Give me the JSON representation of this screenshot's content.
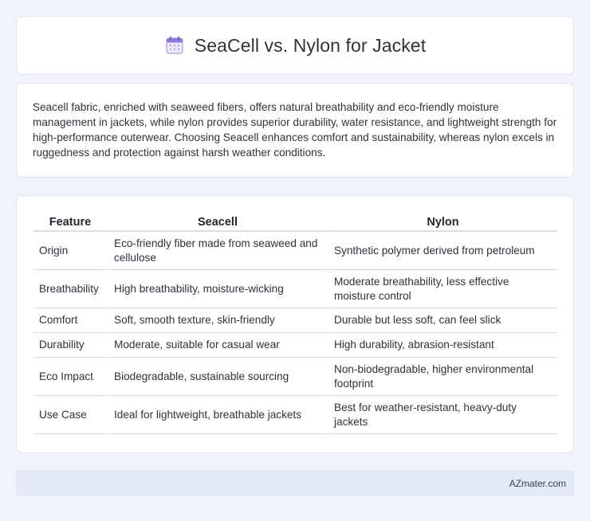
{
  "header": {
    "title": "SeaCell vs. Nylon for Jacket",
    "icon": "calendar-icon",
    "icon_color": "#8b7bd9"
  },
  "description": "Seacell fabric, enriched with seaweed fibers, offers natural breathability and eco-friendly moisture management in jackets, while nylon provides superior durability, water resistance, and lightweight strength for high-performance outerwear. Choosing Seacell enhances comfort and sustainability, whereas nylon excels in ruggedness and protection against harsh weather conditions.",
  "table": {
    "headers": [
      "Feature",
      "Seacell",
      "Nylon"
    ],
    "rows": [
      [
        "Origin",
        "Eco-friendly fiber made from seaweed and cellulose",
        "Synthetic polymer derived from petroleum"
      ],
      [
        "Breathability",
        "High breathability, moisture-wicking",
        "Moderate breathability, less effective moisture control"
      ],
      [
        "Comfort",
        "Soft, smooth texture, skin-friendly",
        "Durable but less soft, can feel slick"
      ],
      [
        "Durability",
        "Moderate, suitable for casual wear",
        "High durability, abrasion-resistant"
      ],
      [
        "Eco Impact",
        "Biodegradable, sustainable sourcing",
        "Non-biodegradable, higher environmental footprint"
      ],
      [
        "Use Case",
        "Ideal for lightweight, breathable jackets",
        "Best for weather-resistant, heavy-duty jackets"
      ]
    ]
  },
  "footer": {
    "brand": "AZmater.com"
  },
  "colors": {
    "background": "#f0f3fa",
    "card": "#ffffff",
    "footer_bg": "#e3e9f6"
  }
}
